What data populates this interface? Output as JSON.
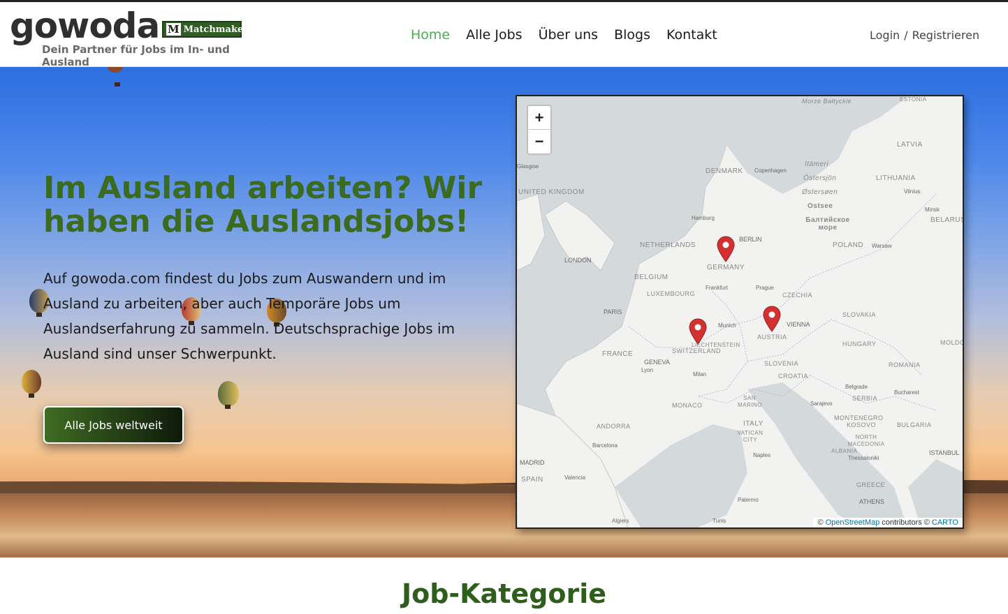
{
  "header": {
    "logo": {
      "word": "gowoda",
      "badge_icon": "M",
      "badge_text": "Matchmaker",
      "tagline": "Dein Partner für Jobs im In- und Ausland"
    },
    "nav": [
      {
        "label": "Home",
        "active": true
      },
      {
        "label": "Alle Jobs",
        "active": false
      },
      {
        "label": "Über uns",
        "active": false
      },
      {
        "label": "Blogs",
        "active": false
      },
      {
        "label": "Kontakt",
        "active": false
      }
    ],
    "auth": {
      "login": "Login",
      "separator": "/",
      "register": "Registrieren"
    }
  },
  "hero": {
    "title": "Im Ausland arbeiten? Wir haben die Auslandsjobs!",
    "text": "Auf gowoda.com findest du Jobs zum Auswandern und im Ausland zu arbeiten, aber auch Temporäre Jobs um Auslandserfahrung zu sammeln. Deutschsprachige Jobs im Ausland sind unser Schwerpunkt.",
    "cta": "Alle Jobs weltweit"
  },
  "map": {
    "zoom_in": "+",
    "zoom_out": "−",
    "attribution": {
      "prefix": "©",
      "osm": "OpenStreetMap",
      "middle": "contributors ©",
      "carto": "CARTO"
    },
    "labels": {
      "estonia": "ESTONIA",
      "latvia": "LATVIA",
      "lithuania": "LITHUANIA",
      "belarus": "BELARUS",
      "denmark": "DENMARK",
      "united_kingdom": "UNITED KINGDOM",
      "netherlands": "NETHERLANDS",
      "germany": "GERMANY",
      "belgium": "BELGIUM",
      "luxembourg": "LUXEMBOURG",
      "poland": "POLAND",
      "czechia": "CZECHIA",
      "slovakia": "SLOVAKIA",
      "austria": "AUSTRIA",
      "hungary": "HUNGARY",
      "switzerland": "SWITZERLAND",
      "liechtenstein": "LIECHTENSTEIN",
      "france": "FRANCE",
      "slovenia": "SLOVENIA",
      "croatia": "CROATIA",
      "romania": "ROMANIA",
      "serbia": "SERBIA",
      "moldova": "MOLDO",
      "monaco": "MONACO",
      "san_marino": "SAN MARINO",
      "andorra": "ANDORRA",
      "italy": "ITALY",
      "vatican": "VATICAN CITY",
      "montenegro": "MONTENEGRO",
      "kosovo": "KOSOVO",
      "bulgaria": "BULGARIA",
      "north_macedonia": "NORTH MACEDONIA",
      "albania": "ALBANIA",
      "spain": "SPAIN",
      "greece": "GREECE",
      "baltic": "Morze Bałtyckie",
      "ostsee": "Ostsee",
      "baltic_ru": "Балтийское море",
      "itameri": "Itämeri",
      "ostersjon": "Östersjön",
      "ostersoen": "Østersøen",
      "london": "LONDON",
      "paris": "PARIS",
      "berlin": "BERLIN",
      "madrid": "MADRID",
      "geneva": "GENEVA",
      "athens": "ATHENS",
      "vienna": "VIENNA",
      "hamburg": "Hamburg",
      "copenhagen": "Copenhagen",
      "frankfurt": "Frankfurt",
      "prague": "Prague",
      "munich": "Munich",
      "milan": "Milan",
      "lyon": "Lyon",
      "warsaw": "Warsaw",
      "vilnius": "Vilnius",
      "minsk": "Minsk",
      "belgrade": "Belgrade",
      "bucharest": "Bucharest",
      "sarajevo": "Sarajevo",
      "barcelona": "Barcelona",
      "valencia": "Valencia",
      "naples": "Naples",
      "thessaloniki": "Thessaloniki",
      "istanbul": "ISTANBUL",
      "palermo": "Palermo",
      "algiers": "Algiers",
      "tunis": "Tunis",
      "glasgow": "Glasgow"
    },
    "markers": [
      "Germany",
      "Liechtenstein",
      "Austria"
    ]
  },
  "section": {
    "title": "Job-Kategorie"
  }
}
